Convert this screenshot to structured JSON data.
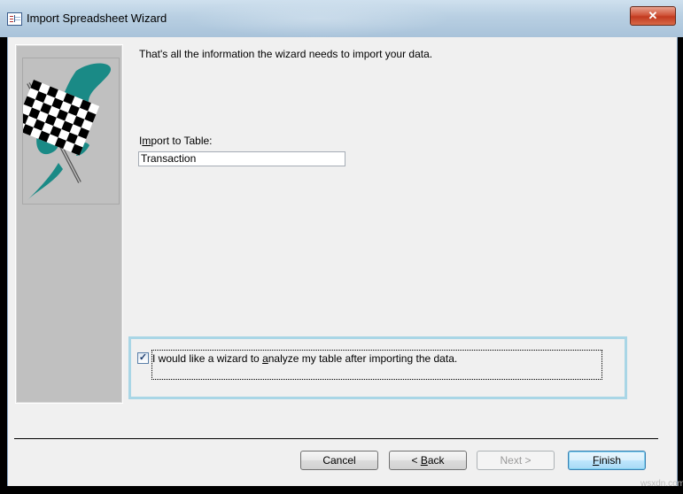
{
  "window": {
    "title": "Import Spreadsheet Wizard",
    "close_label": "✕"
  },
  "main": {
    "info_text": "That's all the information the wizard needs to import your data.",
    "import_label_pre": "I",
    "import_label_mnemonic": "m",
    "import_label_post": "port to Table:",
    "table_name_value": "Transaction",
    "analyze_checked": true,
    "analyze_check_glyph": "✓",
    "analyze_label_pre": "I would like a wizard to ",
    "analyze_label_mnemonic": "a",
    "analyze_label_post": "nalyze my table after importing the data."
  },
  "buttons": {
    "cancel": "Cancel",
    "back_pre": "< ",
    "back_mnemonic": "B",
    "back_post": "ack",
    "next": "Next >",
    "finish_mnemonic": "F",
    "finish_post": "inish"
  },
  "watermark": "wsxdn.com",
  "colors": {
    "highlight_border": "#a9d6e6",
    "flag_teal": "#1a8a86",
    "close_red": "#c23a20"
  }
}
